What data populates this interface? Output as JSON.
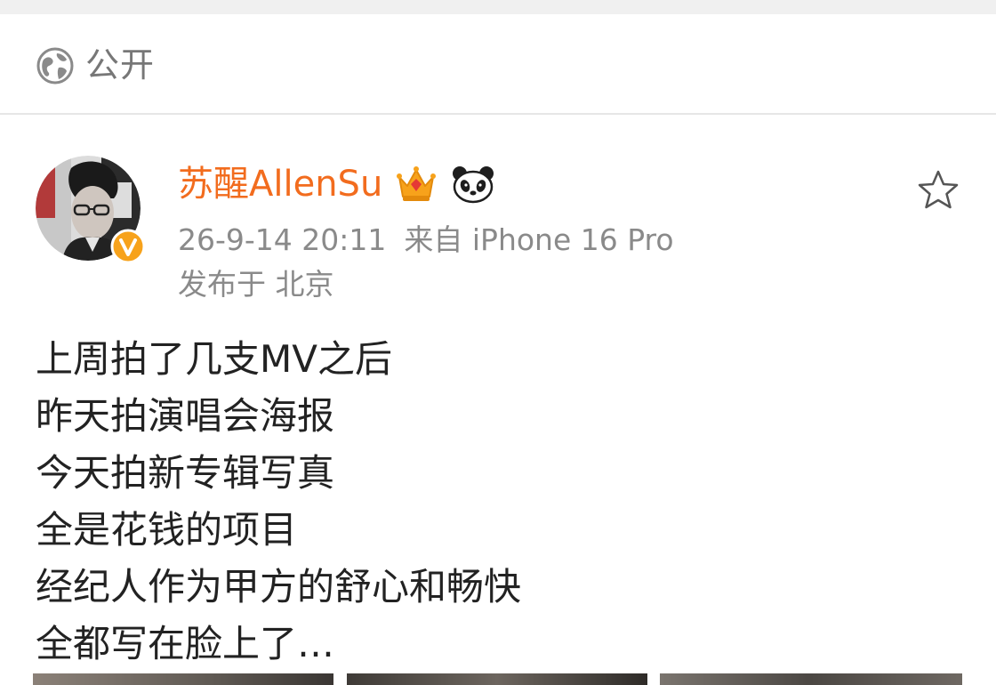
{
  "visibility": {
    "icon": "globe-icon",
    "label": "公开"
  },
  "post": {
    "author": {
      "name": "苏醒AllenSu",
      "verified_badge_icon": "verified-v-icon",
      "member_badge_icon": "crown-icon",
      "sticker_badge_icon": "panda-icon"
    },
    "timestamp": "26-9-14 20:11",
    "source": "来自 iPhone 16 Pro",
    "location": "发布于 北京",
    "favorite_icon": "star-icon",
    "lines": [
      "上周拍了几支MV之后",
      "昨天拍演唱会海报",
      "今天拍新专辑写真",
      "全是花钱的项目",
      "经纪人作为甲方的舒心和畅快",
      "全都写在脸上了…"
    ],
    "images_count": 3
  },
  "colors": {
    "username": "#f26c1e",
    "meta_text": "#8a8a8a",
    "body_text": "#222222",
    "verified_badge": "#f7a21b"
  }
}
